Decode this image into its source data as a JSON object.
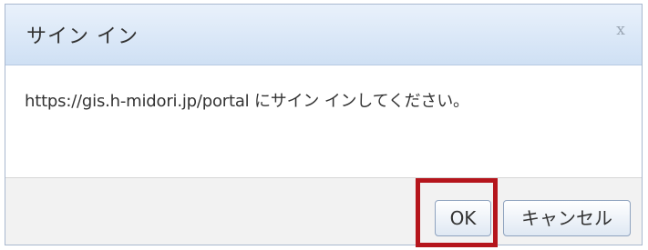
{
  "dialog": {
    "title": "サイン イン",
    "close_label": "x",
    "message": "https://gis.h-midori.jp/portal にサイン インしてください。",
    "ok_label": "OK",
    "cancel_label": "キャンセル"
  },
  "highlight": {
    "target": "ok-button",
    "color": "#b5151c"
  },
  "colors": {
    "titlebar_top": "#e9f1fb",
    "titlebar_bottom": "#cfe0f4",
    "footer_bg": "#f2f2f2"
  },
  "icons": {
    "close": "close-icon"
  }
}
